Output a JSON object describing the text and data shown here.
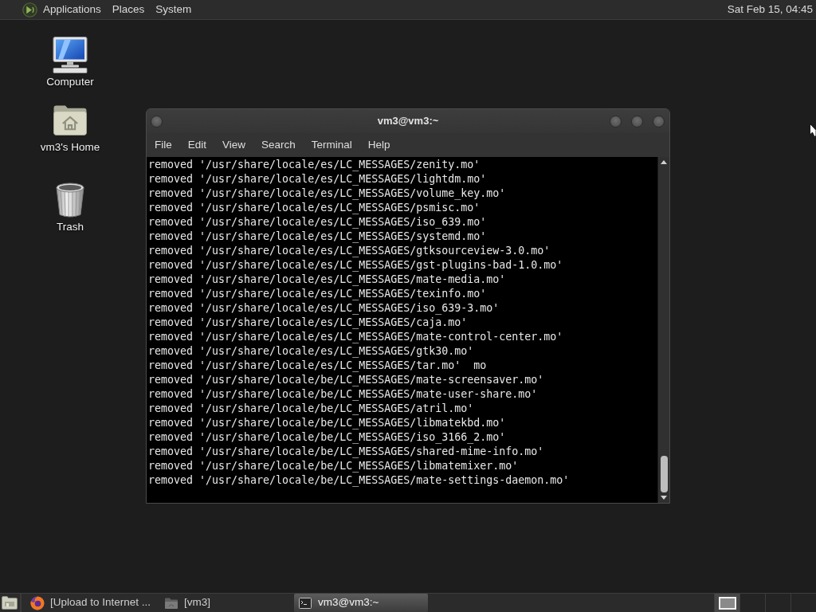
{
  "top_panel": {
    "menus": [
      "Applications",
      "Places",
      "System"
    ],
    "clock": "Sat Feb 15, 04:45"
  },
  "desktop_icons": [
    {
      "kind": "computer",
      "label": "Computer"
    },
    {
      "kind": "home",
      "label": "vm3's Home"
    },
    {
      "kind": "trash",
      "label": "Trash"
    }
  ],
  "window": {
    "title": "vm3@vm3:~",
    "menu": [
      "File",
      "Edit",
      "View",
      "Search",
      "Terminal",
      "Help"
    ],
    "lines": [
      "removed '/usr/share/locale/es/LC_MESSAGES/zenity.mo'",
      "removed '/usr/share/locale/es/LC_MESSAGES/lightdm.mo'",
      "removed '/usr/share/locale/es/LC_MESSAGES/volume_key.mo'",
      "removed '/usr/share/locale/es/LC_MESSAGES/psmisc.mo'",
      "removed '/usr/share/locale/es/LC_MESSAGES/iso_639.mo'",
      "removed '/usr/share/locale/es/LC_MESSAGES/systemd.mo'",
      "removed '/usr/share/locale/es/LC_MESSAGES/gtksourceview-3.0.mo'",
      "removed '/usr/share/locale/es/LC_MESSAGES/gst-plugins-bad-1.0.mo'",
      "removed '/usr/share/locale/es/LC_MESSAGES/mate-media.mo'",
      "removed '/usr/share/locale/es/LC_MESSAGES/texinfo.mo'",
      "removed '/usr/share/locale/es/LC_MESSAGES/iso_639-3.mo'",
      "removed '/usr/share/locale/es/LC_MESSAGES/caja.mo'",
      "removed '/usr/share/locale/es/LC_MESSAGES/mate-control-center.mo'",
      "removed '/usr/share/locale/es/LC_MESSAGES/gtk30.mo'",
      "removed '/usr/share/locale/es/LC_MESSAGES/tar.mo'  mo",
      "removed '/usr/share/locale/be/LC_MESSAGES/mate-screensaver.mo'",
      "removed '/usr/share/locale/be/LC_MESSAGES/mate-user-share.mo'",
      "removed '/usr/share/locale/be/LC_MESSAGES/atril.mo'",
      "removed '/usr/share/locale/be/LC_MESSAGES/libmatekbd.mo'",
      "removed '/usr/share/locale/be/LC_MESSAGES/iso_3166_2.mo'",
      "removed '/usr/share/locale/be/LC_MESSAGES/shared-mime-info.mo'",
      "removed '/usr/share/locale/be/LC_MESSAGES/libmatemixer.mo'",
      "removed '/usr/share/locale/be/LC_MESSAGES/mate-settings-daemon.mo'"
    ]
  },
  "bottom_panel": {
    "tasks": [
      {
        "kind": "browser",
        "label": "[Upload to Internet ...",
        "selected": false
      },
      {
        "kind": "folder",
        "label": "[vm3]",
        "selected": false
      },
      {
        "kind": "terminal",
        "label": "vm3@vm3:~",
        "selected": true
      }
    ],
    "workspaces": [
      {
        "selected": true,
        "has_windows": true
      },
      {
        "selected": false,
        "has_windows": false
      },
      {
        "selected": false,
        "has_windows": false
      },
      {
        "selected": false,
        "has_windows": false
      }
    ]
  }
}
